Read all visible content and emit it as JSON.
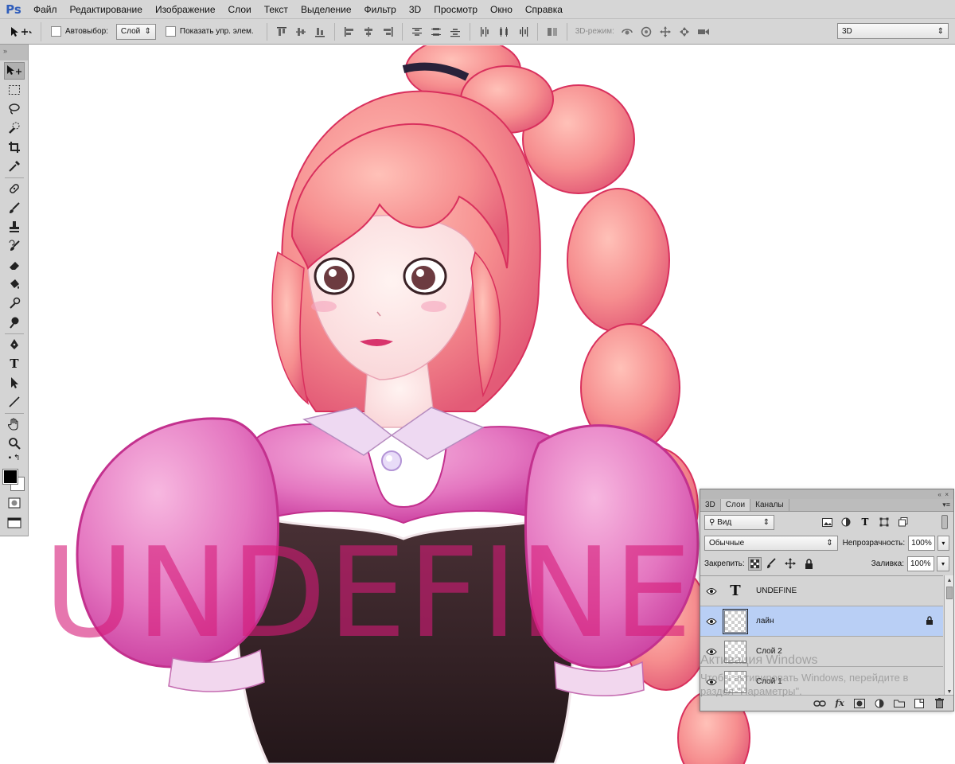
{
  "app": {
    "logo": "Ps"
  },
  "menu": [
    "Файл",
    "Редактирование",
    "Изображение",
    "Слои",
    "Текст",
    "Выделение",
    "Фильтр",
    "3D",
    "Просмотр",
    "Окно",
    "Справка"
  ],
  "options": {
    "autoselect_label": "Автовыбор:",
    "autoselect_value": "Слой",
    "show_controls_label": "Показать упр. элем.",
    "mode3d_label": "3D-режим:",
    "workspace_value": "3D"
  },
  "canvas": {
    "watermark_text": "UNDEFINE"
  },
  "layers_panel": {
    "tabs": [
      "3D",
      "Слои",
      "Каналы"
    ],
    "active_tab": "Слои",
    "filter_value": "Вид",
    "blend_mode": "Обычные",
    "opacity_label": "Непрозрачность:",
    "opacity_value": "100%",
    "lock_label": "Закрепить:",
    "fill_label": "Заливка:",
    "fill_value": "100%",
    "layers": [
      {
        "name": "UNDEFINE",
        "kind": "text",
        "visible": true,
        "selected": false,
        "locked": false
      },
      {
        "name": "лайн",
        "kind": "raster",
        "visible": true,
        "selected": true,
        "locked": true
      },
      {
        "name": "Слой 2",
        "kind": "raster",
        "visible": true,
        "selected": false,
        "locked": false
      },
      {
        "name": "Слой 1",
        "kind": "raster",
        "visible": true,
        "selected": false,
        "locked": false
      }
    ]
  },
  "windows_activation": {
    "title": "Активация Windows",
    "line1": "Чтобы активировать Windows, перейдите в",
    "line2": "раздел \"Параметры\"."
  },
  "colors": {
    "foreground": "#000000",
    "background": "#ffffff",
    "selection": "#b9cff5",
    "watermark": "#d61a78"
  }
}
